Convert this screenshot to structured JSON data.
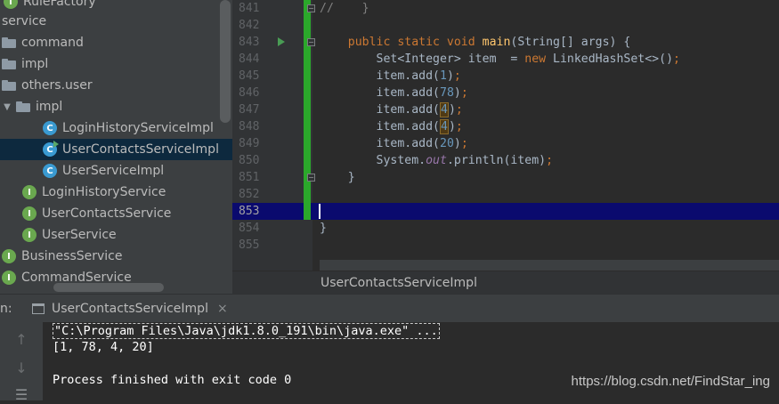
{
  "tree": {
    "rows": [
      {
        "label": "RuleFactory",
        "type": "interface"
      },
      {
        "label": "service",
        "type": "text"
      },
      {
        "label": "command",
        "type": "package"
      },
      {
        "label": "impl",
        "type": "package"
      },
      {
        "label": "others.user",
        "type": "package"
      },
      {
        "label": "impl",
        "type": "package-open"
      },
      {
        "label": "LoginHistoryServiceImpl",
        "type": "class"
      },
      {
        "label": "UserContactsServiceImpl",
        "type": "class-run",
        "selected": true
      },
      {
        "label": "UserServiceImpl",
        "type": "class"
      },
      {
        "label": "LoginHistoryService",
        "type": "interface"
      },
      {
        "label": "UserContactsService",
        "type": "interface"
      },
      {
        "label": "UserService",
        "type": "interface"
      },
      {
        "label": "BusinessService",
        "type": "interface"
      },
      {
        "label": "CommandService",
        "type": "interface"
      }
    ]
  },
  "editor": {
    "line_numbers": [
      "841",
      "842",
      "843",
      "844",
      "845",
      "846",
      "847",
      "848",
      "849",
      "850",
      "851",
      "852",
      "853",
      "854",
      "855"
    ],
    "current_line": "853",
    "code": {
      "l841": "//    }",
      "l843_kw": "public static void ",
      "l843_fn": "main",
      "l843_rest": "(String[] args) {",
      "l844_a": "Set<Integer> item  = ",
      "l844_kw": "new",
      "l844_b": " LinkedHashSet<>()",
      "semi": ";",
      "add_prefix": "item.add(",
      "add_suffix": ")",
      "v1": "1",
      "v2": "78",
      "v3": "4",
      "v4": "4",
      "v5": "20",
      "l850_a": "System.",
      "l850_out": "out",
      "l850_b": ".println(item)",
      "brace_close": "}"
    }
  },
  "breadcrumb": {
    "label": "UserContactsServiceImpl"
  },
  "run_panel": {
    "label": "n:",
    "tab_label": "UserContactsServiceImpl",
    "close": "×"
  },
  "console": {
    "command": "\"C:\\Program Files\\Java\\jdk1.8.0_191\\bin\\java.exe\" ...",
    "output": "[1, 78, 4, 20]",
    "finished": "Process finished with exit code 0"
  },
  "watermark": "https://blog.csdn.net/FindStar_ing",
  "colors": {
    "keyword": "#cc7832",
    "number": "#6897bb",
    "method": "#ffc66d",
    "selection": "#0d293e",
    "current_line": "#0a0a6e"
  }
}
